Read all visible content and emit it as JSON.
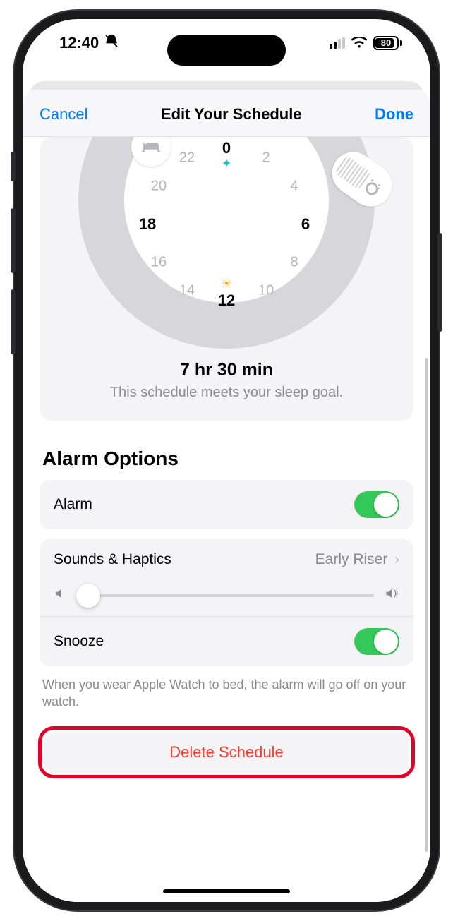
{
  "status": {
    "time": "12:40",
    "battery": "80"
  },
  "nav": {
    "cancel": "Cancel",
    "title": "Edit Your Schedule",
    "done": "Done"
  },
  "clock": {
    "hours": {
      "h0": "0",
      "h2": "2",
      "h4": "4",
      "h6": "6",
      "h8": "8",
      "h10": "10",
      "h12": "12",
      "h14": "14",
      "h16": "16",
      "h18": "18",
      "h20": "20",
      "h22": "22"
    },
    "duration": "7 hr 30 min",
    "goal_text": "This schedule meets your sleep goal."
  },
  "alarm": {
    "section_title": "Alarm Options",
    "alarm_label": "Alarm",
    "alarm_on": true,
    "sounds_label": "Sounds & Haptics",
    "sounds_value": "Early Riser",
    "volume_percent": 4,
    "snooze_label": "Snooze",
    "snooze_on": true,
    "footer": "When you wear Apple Watch to bed, the alarm will go off on your watch."
  },
  "delete_label": "Delete Schedule"
}
